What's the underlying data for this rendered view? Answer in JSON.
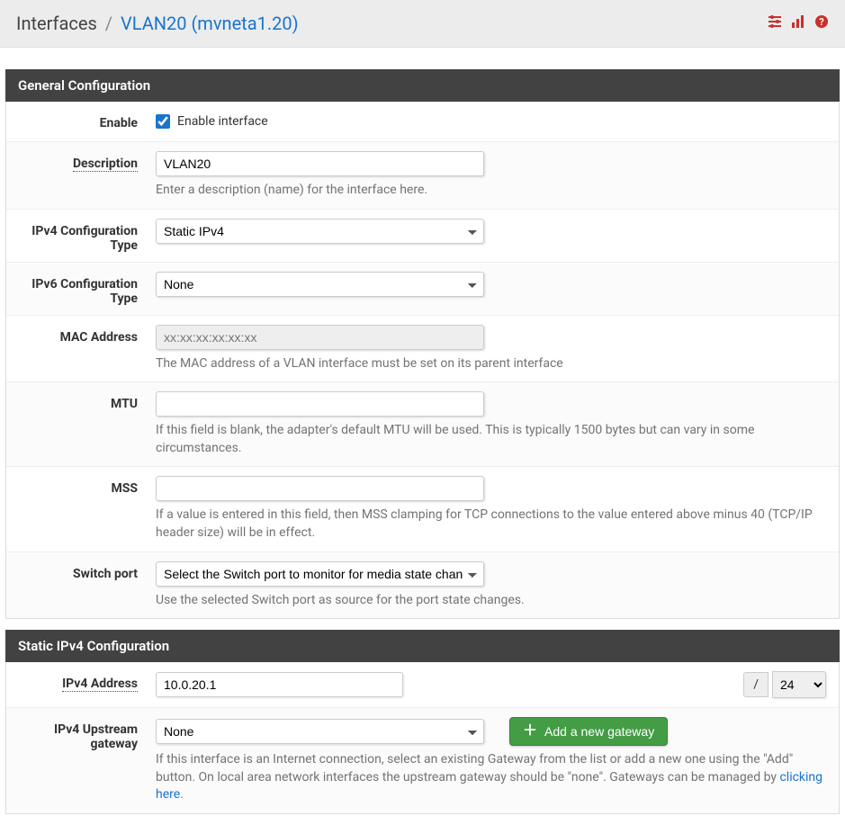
{
  "header": {
    "breadcrumb_root": "Interfaces",
    "breadcrumb_sep": "/",
    "breadcrumb_current": "VLAN20 (mvneta1.20)"
  },
  "panels": {
    "general": {
      "title": "General Configuration",
      "enable": {
        "label": "Enable",
        "checkbox_label": "Enable interface",
        "checked": true
      },
      "description": {
        "label": "Description",
        "value": "VLAN20",
        "help": "Enter a description (name) for the interface here."
      },
      "ipv4type": {
        "label": "IPv4 Configuration Type",
        "value": "Static IPv4"
      },
      "ipv6type": {
        "label": "IPv6 Configuration Type",
        "value": "None"
      },
      "mac": {
        "label": "MAC Address",
        "placeholder": "xx:xx:xx:xx:xx:xx",
        "help": "The MAC address of a VLAN interface must be set on its parent interface"
      },
      "mtu": {
        "label": "MTU",
        "value": "",
        "help": "If this field is blank, the adapter's default MTU will be used. This is typically 1500 bytes but can vary in some circumstances."
      },
      "mss": {
        "label": "MSS",
        "value": "",
        "help": "If a value is entered in this field, then MSS clamping for TCP connections to the value entered above minus 40 (TCP/IP header size) will be in effect."
      },
      "switchport": {
        "label": "Switch port",
        "value": "Select the Switch port to monitor for media state changes",
        "help": "Use the selected Switch port as source for the port state changes."
      }
    },
    "staticv4": {
      "title": "Static IPv4 Configuration",
      "ipv4addr": {
        "label": "IPv4 Address",
        "value": "10.0.20.1",
        "slash": "/",
        "cidr": "24"
      },
      "gateway": {
        "label": "IPv4 Upstream gateway",
        "value": "None",
        "button": "Add a new gateway",
        "help_pre": "If this interface is an Internet connection, select an existing Gateway from the list or add a new one using the \"Add\" button. On local area network interfaces the upstream gateway should be \"none\". Gateways can be managed by ",
        "help_link": "clicking here",
        "help_post": "."
      }
    }
  }
}
